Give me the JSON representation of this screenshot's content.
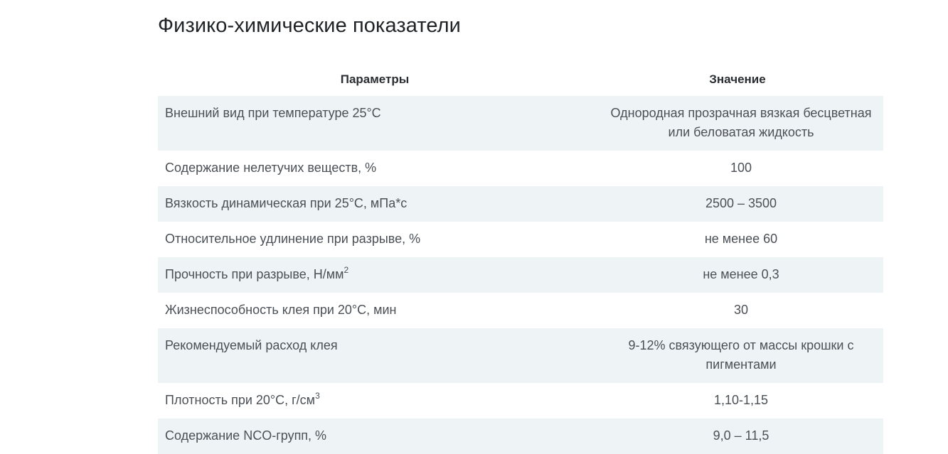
{
  "page": {
    "title": "Физико-химические показатели"
  },
  "table": {
    "headers": [
      "Параметры",
      "Значение"
    ],
    "rows": [
      {
        "param": "Внешний вид при температуре 25°С",
        "sup": "",
        "value": "Однородная прозрачная вязкая бесцветная или беловатая жидкость"
      },
      {
        "param": "Содержание нелетучих веществ, %",
        "sup": "",
        "value": "100"
      },
      {
        "param": "Вязкость динамическая при 25°С, мПа*с",
        "sup": "",
        "value": "2500 – 3500"
      },
      {
        "param": "Относительное удлинение при разрыве, %",
        "sup": "",
        "value": "не менее 60"
      },
      {
        "param": "Прочность при разрыве, Н/мм",
        "sup": "2",
        "value": "не менее 0,3"
      },
      {
        "param": "Жизнеспособность клея при 20°С, мин",
        "sup": "",
        "value": "30"
      },
      {
        "param": "Рекомендуемый расход клея",
        "sup": "",
        "value": "9-12% связующего от массы крошки с пигментами"
      },
      {
        "param": "Плотность при 20°С, г/см",
        "sup": "3",
        "value": "1,10-1,15"
      },
      {
        "param": "Содержание NCO-групп, %",
        "sup": "",
        "value": "9,0 – 11,5"
      }
    ]
  }
}
